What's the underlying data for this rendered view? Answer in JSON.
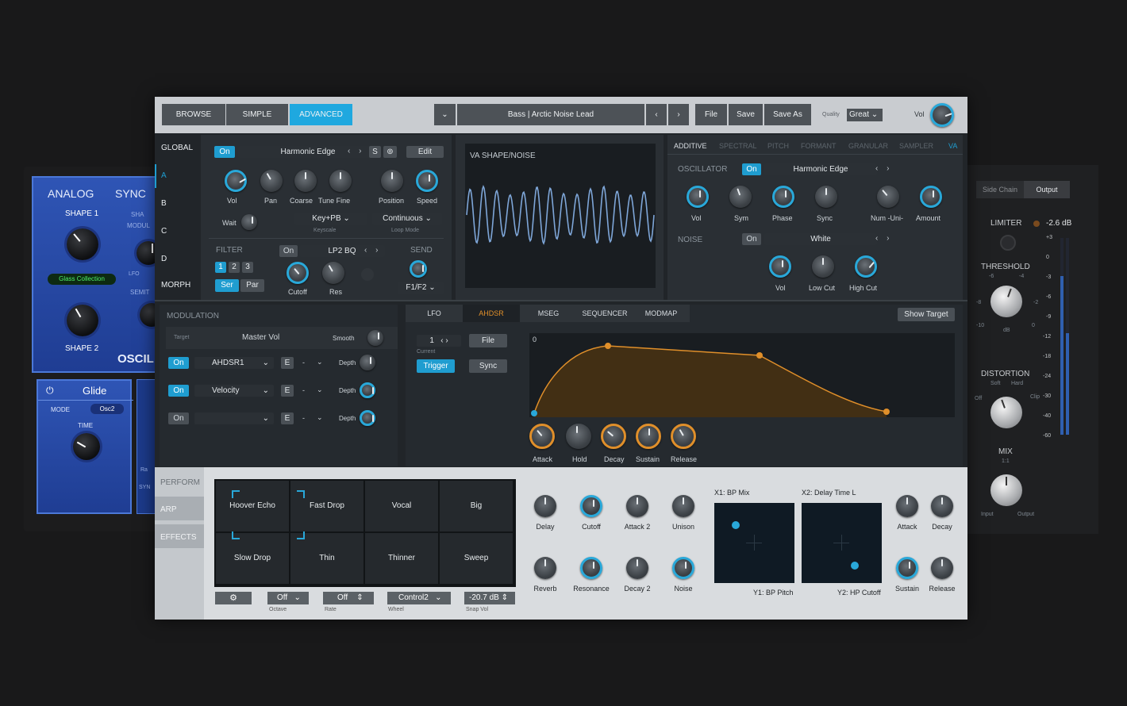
{
  "left_plugin": {
    "analog": "ANALOG",
    "sync": "SYNC",
    "shape1": "SHAPE 1",
    "shape2": "SHAPE 2",
    "modul": "MODUL",
    "lfo": "LFO",
    "semit": "SEMIT",
    "sha": "SHA",
    "glass": "Glass Collection",
    "osci": "OSCIL",
    "glide": "Glide",
    "mode": "MODE",
    "mode_val": "Osc2",
    "time": "TIME",
    "ra": "Ra",
    "syn": "SYN"
  },
  "topbar": {
    "browse": "BROWSE",
    "simple": "SIMPLE",
    "advanced": "ADVANCED",
    "preset": "Bass | Arctic Noise Lead",
    "file": "File",
    "save": "Save",
    "save_as": "Save As",
    "quality_label": "Quality",
    "quality": "Great",
    "vol": "Vol"
  },
  "sidebar": {
    "global": "GLOBAL",
    "a": "A",
    "b": "B",
    "c": "C",
    "d": "D",
    "morph": "MORPH"
  },
  "osc": {
    "on": "On",
    "name": "Harmonic Edge",
    "s": "S",
    "edit": "Edit",
    "knobs": [
      "Vol",
      "Pan",
      "Coarse",
      "Tune Fine",
      "Position",
      "Speed"
    ],
    "wait": "Wait",
    "keyscale_val": "Key+PB",
    "keyscale": "Keyscale",
    "loop_val": "Continuous",
    "loop": "Loop Mode"
  },
  "filter": {
    "title": "FILTER",
    "on": "On",
    "type": "LP2 BQ",
    "n1": "1",
    "n2": "2",
    "n3": "3",
    "ser": "Ser",
    "par": "Par",
    "cutoff": "Cutoff",
    "res": "Res",
    "send": "SEND",
    "send_val": "F1/F2"
  },
  "wave": {
    "title": "VA SHAPE/NOISE"
  },
  "right_tabs": [
    "ADDITIVE",
    "SPECTRAL",
    "PITCH",
    "FORMANT",
    "GRANULAR",
    "SAMPLER",
    "VA"
  ],
  "va": {
    "oscillator": "OSCILLATOR",
    "on": "On",
    "osc_name": "Harmonic Edge",
    "osc_knobs": [
      "Vol",
      "Sym",
      "Phase",
      "Sync",
      "Num -Uni-",
      "Amount"
    ],
    "noise": "NOISE",
    "noise_on": "On",
    "noise_type": "White",
    "noise_knobs": [
      "Vol",
      "Low Cut",
      "High Cut"
    ]
  },
  "modulation": {
    "title": "MODULATION",
    "target": "Target",
    "target_val": "Master Vol",
    "smooth": "Smooth",
    "rows": [
      {
        "on": "On",
        "src": "AHDSR1",
        "e": "E",
        "dash": "-",
        "depth": "Depth"
      },
      {
        "on": "On",
        "src": "Velocity",
        "e": "E",
        "dash": "-",
        "depth": "Depth"
      },
      {
        "on": "On",
        "src": "",
        "e": "E",
        "dash": "-",
        "depth": "Depth"
      }
    ]
  },
  "env": {
    "tabs": [
      "LFO",
      "AHDSR",
      "MSEG",
      "SEQUENCER",
      "MODMAP"
    ],
    "show_target": "Show Target",
    "current_val": "1",
    "current": "Current",
    "file": "File",
    "trigger": "Trigger",
    "sync": "Sync",
    "zero": "0",
    "knobs": [
      "Attack",
      "Hold",
      "Decay",
      "Sustain",
      "Release"
    ]
  },
  "perform": {
    "perform": "PERFORM",
    "arp": "ARP",
    "effects": "EFFECTS",
    "pads": [
      "Hoover Echo",
      "Fast Drop",
      "Vocal",
      "Big",
      "Slow Drop",
      "Thin",
      "Thinner",
      "Sweep"
    ],
    "octave_val": "Off",
    "octave": "Octave",
    "rate_val": "Off",
    "rate": "Rate",
    "wheel_val": "Control2",
    "wheel": "Wheel",
    "snap_val": "-20.7 dB",
    "snap": "Snap Vol"
  },
  "macros": {
    "knobs": [
      "Delay",
      "Cutoff",
      "Attack 2",
      "Unison",
      "Reverb",
      "Resonance",
      "Decay 2",
      "Noise"
    ],
    "x1": "X1: BP Mix",
    "y1": "Y1: BP Pitch",
    "x2": "X2: Delay Time L",
    "y2": "Y2: HP Cutoff",
    "right_knobs": [
      "Attack",
      "Decay",
      "Sustain",
      "Release"
    ]
  },
  "right_plugin": {
    "side_chain": "Side Chain",
    "output": "Output",
    "limiter": "LIMITER",
    "limiter_val": "-2.6 dB",
    "threshold": "THRESHOLD",
    "thr_scale": [
      "-6",
      "-4",
      "-8",
      "-2",
      "-10",
      "dB",
      "0"
    ],
    "distortion": "DISTORTION",
    "soft": "Soft",
    "hard": "Hard",
    "off": "Off",
    "clip": "Clip",
    "mix": "MIX",
    "ratio": "1:1",
    "input": "Input",
    "output_lbl": "Output",
    "meter": [
      "+3",
      "0",
      "-3",
      "-6",
      "-9",
      "-12",
      "-18",
      "-24",
      "-30",
      "-40",
      "-60"
    ]
  },
  "colors": {
    "accent": "#1f9dd0",
    "orange": "#e08f2a",
    "wave": "#7ea6d8"
  }
}
